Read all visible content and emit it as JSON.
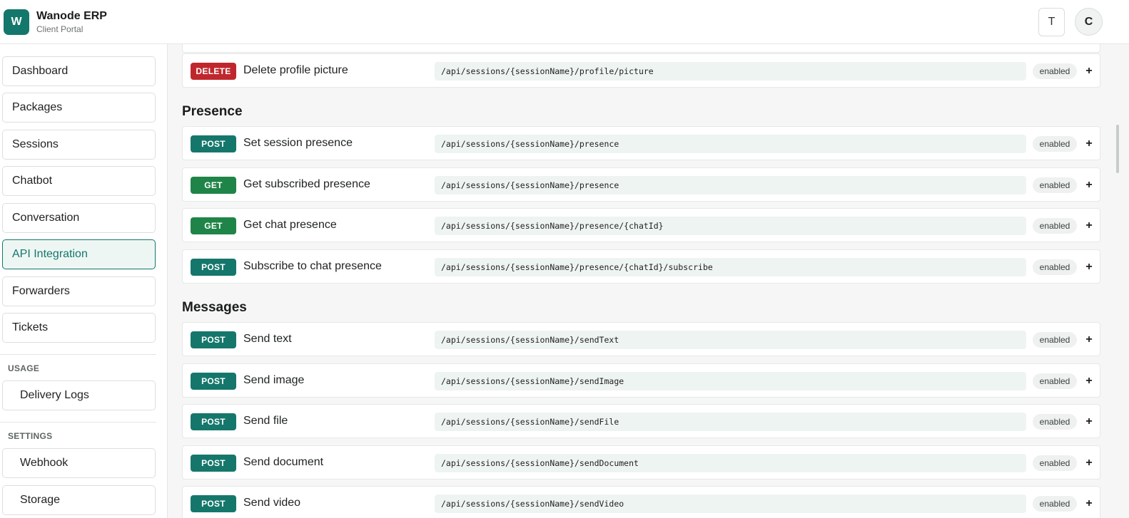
{
  "header": {
    "logo_letter": "W",
    "app_name": "Wanode ERP",
    "app_subtitle": "Client Portal",
    "theme_button_label": "T",
    "avatar_initial": "C"
  },
  "sidebar": {
    "items": [
      {
        "label": "Dashboard",
        "active": false
      },
      {
        "label": "Packages",
        "active": false
      },
      {
        "label": "Sessions",
        "active": false
      },
      {
        "label": "Chatbot",
        "active": false
      },
      {
        "label": "Conversation",
        "active": false
      },
      {
        "label": "API Integration",
        "active": true
      },
      {
        "label": "Forwarders",
        "active": false
      },
      {
        "label": "Tickets",
        "active": false
      }
    ],
    "usage": {
      "title": "USAGE",
      "items": [
        {
          "label": "Delivery Logs"
        }
      ]
    },
    "settings": {
      "title": "SETTINGS",
      "items": [
        {
          "label": "Webhook"
        },
        {
          "label": "Storage"
        }
      ]
    }
  },
  "main": {
    "top_row": {
      "method": "DELETE",
      "title": "Delete profile picture",
      "path": "/api/sessions/{sessionName}/profile/picture",
      "status": "enabled",
      "add_label": "+"
    },
    "groups": [
      {
        "title": "Presence",
        "endpoints": [
          {
            "method": "POST",
            "title": "Set session presence",
            "path": "/api/sessions/{sessionName}/presence",
            "status": "enabled",
            "add_label": "+"
          },
          {
            "method": "GET",
            "title": "Get subscribed presence",
            "path": "/api/sessions/{sessionName}/presence",
            "status": "enabled",
            "add_label": "+"
          },
          {
            "method": "GET",
            "title": "Get chat presence",
            "path": "/api/sessions/{sessionName}/presence/{chatId}",
            "status": "enabled",
            "add_label": "+"
          },
          {
            "method": "POST",
            "title": "Subscribe to chat presence",
            "path": "/api/sessions/{sessionName}/presence/{chatId}/subscribe",
            "status": "enabled",
            "add_label": "+"
          }
        ]
      },
      {
        "title": "Messages",
        "endpoints": [
          {
            "method": "POST",
            "title": "Send text",
            "path": "/api/sessions/{sessionName}/sendText",
            "status": "enabled",
            "add_label": "+"
          },
          {
            "method": "POST",
            "title": "Send image",
            "path": "/api/sessions/{sessionName}/sendImage",
            "status": "enabled",
            "add_label": "+"
          },
          {
            "method": "POST",
            "title": "Send file",
            "path": "/api/sessions/{sessionName}/sendFile",
            "status": "enabled",
            "add_label": "+"
          },
          {
            "method": "POST",
            "title": "Send document",
            "path": "/api/sessions/{sessionName}/sendDocument",
            "status": "enabled",
            "add_label": "+"
          },
          {
            "method": "POST",
            "title": "Send video",
            "path": "/api/sessions/{sessionName}/sendVideo",
            "status": "enabled",
            "add_label": "+"
          }
        ]
      }
    ]
  },
  "colors": {
    "accent": "#13776b",
    "post": "#15776b",
    "get": "#1f8447",
    "delete": "#c0272d"
  }
}
